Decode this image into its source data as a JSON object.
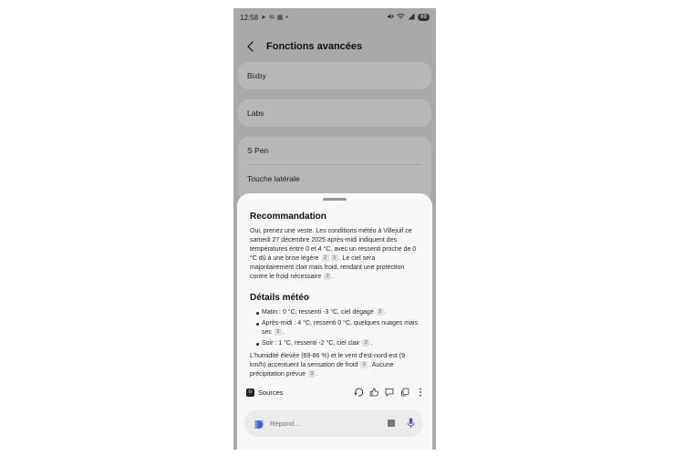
{
  "status_bar": {
    "time": "12:58",
    "left_icons": [
      "send-icon",
      "message-icon",
      "gallery-icon",
      "dot-icon"
    ],
    "right_icons": [
      "mute-icon",
      "wifi-icon",
      "signal-icon"
    ],
    "battery": "69"
  },
  "header": {
    "title": "Fonctions avancées"
  },
  "settings": {
    "bixby": "Bixby",
    "labs": "Labs",
    "s_pen": "S Pen",
    "side_key": "Touche latérale"
  },
  "sheet": {
    "recommendation": {
      "title": "Recommandation",
      "text_1": "Oui, prenez une veste. Les conditions météo à Villejuif ce samedi 27 décembre 2025 après-midi indiquent des températures entre 0 et 4 °C, avec un ressenti proche de 0 °C dû à une brise légère",
      "badge_1": "2",
      "badge_2": "3",
      "text_2": ". Le ciel sera majoritairement clair mais froid, rendant une protection contre le froid nécessaire",
      "badge_3": "2",
      "text_3": "."
    },
    "details": {
      "title": "Détails météo",
      "items": [
        {
          "text": "Matin : 0 °C, ressenti -3 °C, ciel dégagé",
          "badge": "2"
        },
        {
          "text": "Après-midi : 4 °C, ressenti 0 °C, quelques nuages mais sec",
          "badge": "2"
        },
        {
          "text": "Soir : 1 °C, ressenti -2 °C, ciel clair",
          "badge": "2"
        }
      ],
      "footer_1": "L'humidité élevée (69-86 %) et le vent d'est-nord-est (9 km/h) accentuent la sensation de froid",
      "badge_a": "2",
      "footer_2": ". Aucune précipitation prévue",
      "badge_b": "3",
      "footer_3": "."
    },
    "sources_label": "Sources",
    "sources_icon_text": "G",
    "action_icons": [
      "regenerate-icon",
      "thumbs-up-icon",
      "feedback-icon",
      "copy-icon",
      "more-icon"
    ],
    "input_placeholder": "Répond..."
  }
}
